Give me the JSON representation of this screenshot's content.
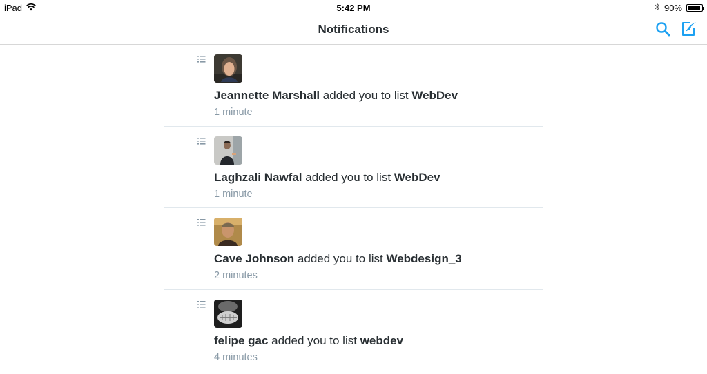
{
  "status_bar": {
    "device": "iPad",
    "time": "5:42 PM",
    "battery_text": "90%",
    "battery_level": 0.9
  },
  "nav": {
    "title": "Notifications",
    "accent_color": "#1da1f2"
  },
  "notifications": [
    {
      "user": "Jeannette Marshall",
      "action": " added you to list ",
      "list": "WebDev",
      "time": "1 minute"
    },
    {
      "user": "Laghzali Nawfal",
      "action": " added you to list ",
      "list": "WebDev",
      "time": "1 minute"
    },
    {
      "user": "Cave Johnson",
      "action": " added you to list ",
      "list": "Webdesign_3",
      "time": "2 minutes"
    },
    {
      "user": "felipe gac",
      "action": " added you to list ",
      "list": "webdev",
      "time": "4 minutes"
    }
  ]
}
